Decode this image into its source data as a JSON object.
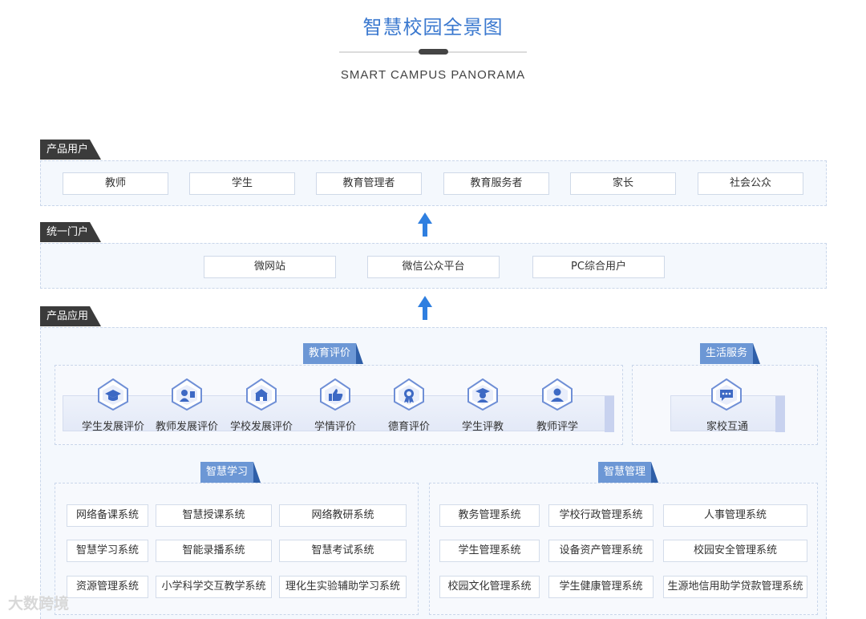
{
  "header": {
    "title": "智慧校园全景图",
    "subtitle": "SMART CAMPUS PANORAMA"
  },
  "users": {
    "tag": "产品用户",
    "items": [
      "教师",
      "学生",
      "教育管理者",
      "教育服务者",
      "家长",
      "社会公众"
    ]
  },
  "portal": {
    "tag": "统一门户",
    "items": [
      "微网站",
      "微信公众平台",
      "PC综合用户"
    ]
  },
  "apps": {
    "tag": "产品应用",
    "evaluation": {
      "tag": "教育评价",
      "items": [
        {
          "label": "学生发展评价",
          "icon": "graduation-cap-icon"
        },
        {
          "label": "教师发展评价",
          "icon": "teacher-icon"
        },
        {
          "label": "学校发展评价",
          "icon": "school-building-icon"
        },
        {
          "label": "学情评价",
          "icon": "thumbs-up-icon"
        },
        {
          "label": "德育评价",
          "icon": "medal-icon"
        },
        {
          "label": "学生评教",
          "icon": "student-icon"
        },
        {
          "label": "教师评学",
          "icon": "person-icon"
        }
      ]
    },
    "life": {
      "tag": "生活服务",
      "items": [
        {
          "label": "家校互通",
          "icon": "chat-icon"
        }
      ]
    },
    "learning": {
      "tag": "智慧学习",
      "rows": [
        [
          "网络备课系统",
          "智慧授课系统",
          "网络教研系统"
        ],
        [
          "智慧学习系统",
          "智能录播系统",
          "智慧考试系统"
        ],
        [
          "资源管理系统",
          "小学科学交互教学系统",
          "理化生实验辅助学习系统"
        ]
      ]
    },
    "management": {
      "tag": "智慧管理",
      "rows": [
        [
          "教务管理系统",
          "学校行政管理系统",
          "人事管理系统"
        ],
        [
          "学生管理系统",
          "设备资产管理系统",
          "校园安全管理系统"
        ],
        [
          "校园文化管理系统",
          "学生健康管理系统",
          "生源地信用助学贷款管理系统"
        ]
      ]
    }
  },
  "watermark": "大数跨境",
  "colors": {
    "title": "#3a78cf",
    "arrow": "#2f7fe0",
    "tag_dark": "#3b3b3b",
    "subtag": "#6c97d5"
  }
}
